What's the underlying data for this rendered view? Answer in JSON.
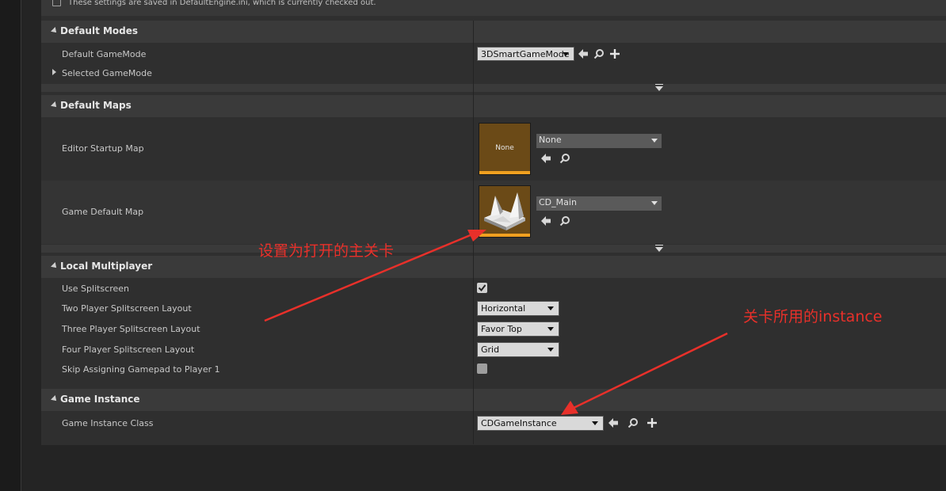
{
  "notice": {
    "text": "These settings are saved in DefaultEngine.ini, which is currently checked out."
  },
  "sections": {
    "default_modes": {
      "title": "Default Modes",
      "rows": {
        "default_gamemode": {
          "label": "Default GameMode",
          "value": "3DSmartGameMode"
        },
        "selected_gamemode": {
          "label": "Selected GameMode"
        }
      }
    },
    "default_maps": {
      "title": "Default Maps",
      "rows": {
        "editor_startup_map": {
          "label": "Editor Startup Map",
          "value": "None",
          "thumb_text": "None"
        },
        "game_default_map": {
          "label": "Game Default Map",
          "value": "CD_Main"
        }
      }
    },
    "local_multiplayer": {
      "title": "Local Multiplayer",
      "rows": {
        "use_splitscreen": {
          "label": "Use Splitscreen",
          "checked": true
        },
        "two_player": {
          "label": "Two Player Splitscreen Layout",
          "value": "Horizontal"
        },
        "three_player": {
          "label": "Three Player Splitscreen Layout",
          "value": "Favor Top"
        },
        "four_player": {
          "label": "Four Player Splitscreen Layout",
          "value": "Grid"
        },
        "skip_gamepad": {
          "label": "Skip Assigning Gamepad to Player 1",
          "checked": false
        }
      }
    },
    "game_instance": {
      "title": "Game Instance",
      "rows": {
        "game_instance_class": {
          "label": "Game Instance Class",
          "value": "CDGameInstance"
        }
      }
    }
  },
  "annotations": {
    "map_note": "设置为打开的主关卡",
    "instance_note": "关卡所用的instance"
  },
  "colors": {
    "annotation": "#e8302a",
    "thumb_strip": "#f0a020",
    "thumb_bg": "#6b4a17"
  }
}
